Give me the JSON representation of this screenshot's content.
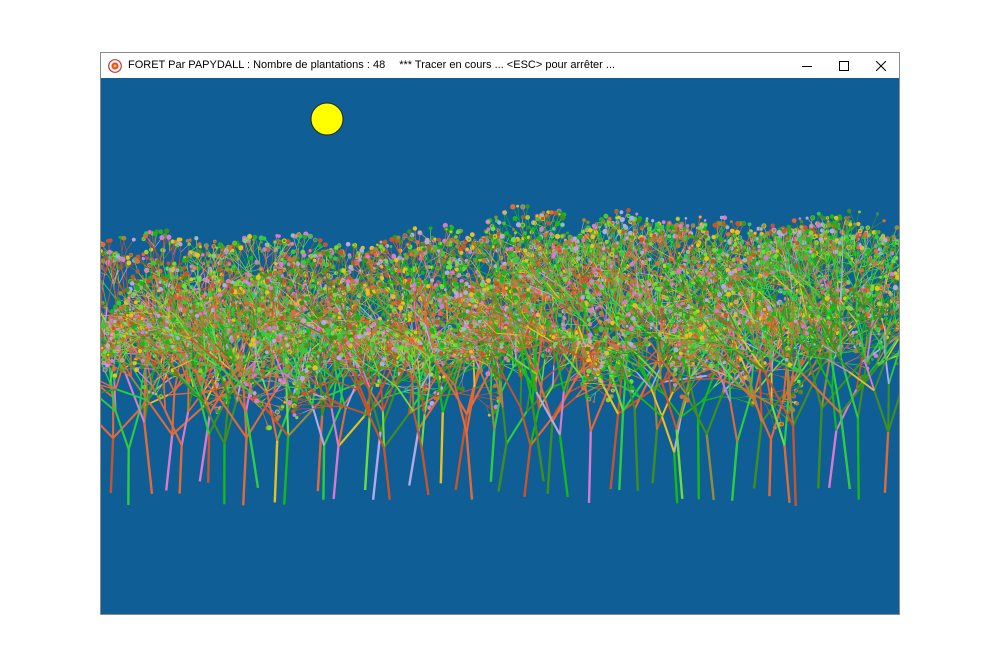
{
  "window": {
    "title": "FORET Par PAPYDALL : Nombre de plantations : 48",
    "status": "*** Tracer en cours ... <ESC> pour arrêter ...",
    "app_icon": "flower-badge-icon",
    "controls": {
      "minimize_icon": "minimize-icon",
      "maximize_icon": "maximize-icon",
      "close_icon": "close-icon"
    }
  },
  "scene": {
    "sky_color": "#0f5f96",
    "sun_color": "#ffff00",
    "plant_colors": [
      "#16b81a",
      "#2ecc40",
      "#6edc3a",
      "#3f8f20",
      "#c8542a",
      "#e06a3a",
      "#b3a9e6",
      "#d77ad0",
      "#e7c21e",
      "#9a8a3a"
    ],
    "plant_count": 48
  }
}
